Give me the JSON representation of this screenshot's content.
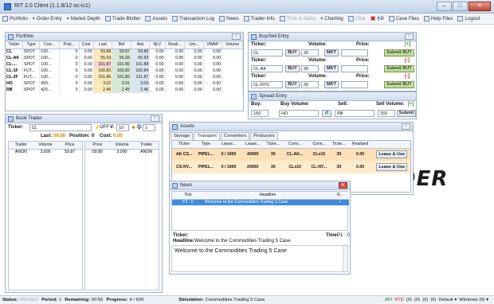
{
  "window": {
    "title": "RIT 2.0 Client (1.1.8/12 oc-ic1)",
    "min": "–",
    "max": "□",
    "close": "✕"
  },
  "menu": [
    {
      "label": "Portfolio",
      "kind": "icon",
      "disabled": false
    },
    {
      "label": "Order Entry",
      "kind": "caret",
      "disabled": false
    },
    {
      "label": "Market Depth",
      "kind": "caret",
      "disabled": false
    },
    {
      "label": "Trade Blotter",
      "kind": "icon",
      "disabled": false
    },
    {
      "label": "Assets",
      "kind": "icon",
      "disabled": false
    },
    {
      "label": "Transaction Log",
      "kind": "icon",
      "disabled": false
    },
    {
      "label": "News",
      "kind": "icon",
      "disabled": false
    },
    {
      "label": "Trader Info",
      "kind": "icon",
      "disabled": false
    },
    {
      "label": "Time & Sales",
      "kind": "icon",
      "disabled": true
    },
    {
      "label": "Charting",
      "kind": "caret",
      "disabled": false
    },
    {
      "label": "Chat",
      "kind": "icon",
      "disabled": true
    },
    {
      "label": "Kill",
      "kind": "red",
      "disabled": false
    },
    {
      "label": "Case Files",
      "kind": "icon",
      "disabled": false
    },
    {
      "label": "Help Files",
      "kind": "icon",
      "disabled": false
    },
    {
      "label": "Logout",
      "kind": "icon",
      "disabled": false
    }
  ],
  "portfolio": {
    "title": "Portfolio",
    "columns": [
      "Ticker",
      "Type",
      "Con...",
      "Posi...",
      "Cost",
      "Last",
      "Bid",
      "Ask",
      "NLV",
      "Reali...",
      "Unr...",
      "VWAP",
      "Volume"
    ],
    "rows": [
      [
        "CL",
        "SPOT",
        "100...",
        "0",
        "0.00",
        "59.88",
        "59.87",
        "59.89",
        "0.00",
        "0.00",
        "0.00",
        "0.00",
        ""
      ],
      [
        "CL-AK",
        "SPOT",
        "100...",
        "0",
        "0.00",
        "55.93",
        "55.93",
        "55.93",
        "0.00",
        "0.00",
        "0.00",
        "0.00",
        ""
      ],
      [
        "CL-...",
        "SPOT",
        "100...",
        "0",
        "0.00",
        "101.87",
        "101.86",
        "101.88",
        "0.00",
        "0.00",
        "0.00",
        "0.00",
        ""
      ],
      [
        "CL-1F",
        "FUT...",
        "100...",
        "0",
        "0.00",
        "100.83",
        "100.82",
        "100.84",
        "0.00",
        "0.00",
        "0.00",
        "0.00",
        ""
      ],
      [
        "CL-2F",
        "FUT...",
        "100...",
        "0",
        "0.00",
        "101.86",
        "101.85",
        "101.87",
        "0.00",
        "0.00",
        "0.00",
        "0.00",
        ""
      ],
      [
        "HO",
        "SPOT",
        "420...",
        "0",
        "0.00",
        "3.02",
        "3.01",
        "3.03",
        "0.00",
        "0.00",
        "0.00",
        "0.00",
        ""
      ],
      [
        "RB",
        "SPOT",
        "420...",
        "0",
        "0.00",
        "2.46",
        "2.45",
        "2.46",
        "0.00",
        "0.00",
        "0.00",
        "0.00",
        ""
      ]
    ]
  },
  "buysell": {
    "title": "Buy/Sell Entry",
    "ticker_label": "Ticker:",
    "volume_label": "Volume:",
    "price_label": "Price:",
    "rows": [
      {
        "ticker": "CL",
        "volume": "30",
        "indicator": "[+]"
      },
      {
        "ticker": "CL-AK",
        "volume": "30",
        "indicator": "[-]"
      },
      {
        "ticker": "CL-NYC",
        "volume": "30",
        "indicator": "[-]"
      }
    ],
    "buy": "BUY",
    "mkt": "MKT",
    "submit": "Submit BUY"
  },
  "spread": {
    "title": "Spread Entry",
    "buy_label": "Buy:",
    "buyvol_label": "Buy Volume:",
    "sell_label": "Sell:",
    "sellvol_label": "Sell Volume:",
    "indicator": "[+]",
    "buy_qty": "150",
    "buy_ticker": "HO",
    "sell_ticker": "RB",
    "sell_qty": "150",
    "submit": "Submit"
  },
  "book": {
    "title": "Book Trader",
    "ticker_label": "Ticker:",
    "ticker": "CL",
    "off": "OFF",
    "v_label": "V:",
    "v_value": "10",
    "q_label": "Q:",
    "q_value": "1",
    "last_label": "Last:",
    "last": "59.88",
    "pos_label": "Position:",
    "pos": "0",
    "cost_label": "Cost:",
    "cost": "0.00",
    "bid_cols": [
      "Trader",
      "Volume",
      "Price"
    ],
    "ask_cols": [
      "Price",
      "Volume",
      "Trader"
    ],
    "bid_row": [
      "ANON",
      "3,600",
      "59.87"
    ],
    "ask_row": [
      "59.89",
      "3,000",
      "ANON"
    ]
  },
  "assets": {
    "title": "Assets",
    "tabs": [
      "Storage",
      "Transport",
      "Converters",
      "Producers"
    ],
    "active_tab": "Transport",
    "columns": [
      "Ticker",
      "Type",
      "Lease...",
      "Lease...",
      "Ticke...",
      "Conv...",
      "Conv...",
      "Ticke...",
      "Realized",
      ""
    ],
    "rows": [
      [
        "AK CS...",
        "PIPEL...",
        "0 / 1000",
        "40000",
        "30",
        "CL-AK...",
        "CLx10",
        "30",
        "0.00",
        "Lease & Use"
      ],
      [
        "CS-NY...",
        "PIPEL...",
        "0 / 1000",
        "20000",
        "30",
        "CLx10",
        "CL-NY...",
        "30",
        "0.00",
        "Lease & Use"
      ]
    ]
  },
  "news": {
    "title": "News",
    "columns": [
      "Tick",
      "Headline",
      "R..."
    ],
    "row": {
      "tick": "P1 : 0",
      "headline": "Welcome to the Commodities Trading 5 Case",
      "read": "✓"
    },
    "ticker_label": "Ticker:",
    "headline_label": "Headline:",
    "time_label": "Time:",
    "time": "P1 : 0",
    "headline": "Welcome to the Commodities Trading 5 Case",
    "body": "Welcome to the Commodities Trading 5 Case"
  },
  "background": {
    "word": "DER"
  },
  "status": {
    "status_label": "Status:",
    "status": "PAUSED",
    "period_label": "Period:",
    "period": "1",
    "remaining_label": "Remaining:",
    "remaining": "00:56",
    "progress_label": "Progress:",
    "progress": "4 / 600",
    "sim_label": "Simulation:",
    "sim": "Commodities Trading 5 Case",
    "right": [
      "API",
      "RTD",
      "(0)",
      "(0)",
      "(0)",
      "(0)",
      "Default ▾",
      "Windows (6) ▾"
    ]
  }
}
